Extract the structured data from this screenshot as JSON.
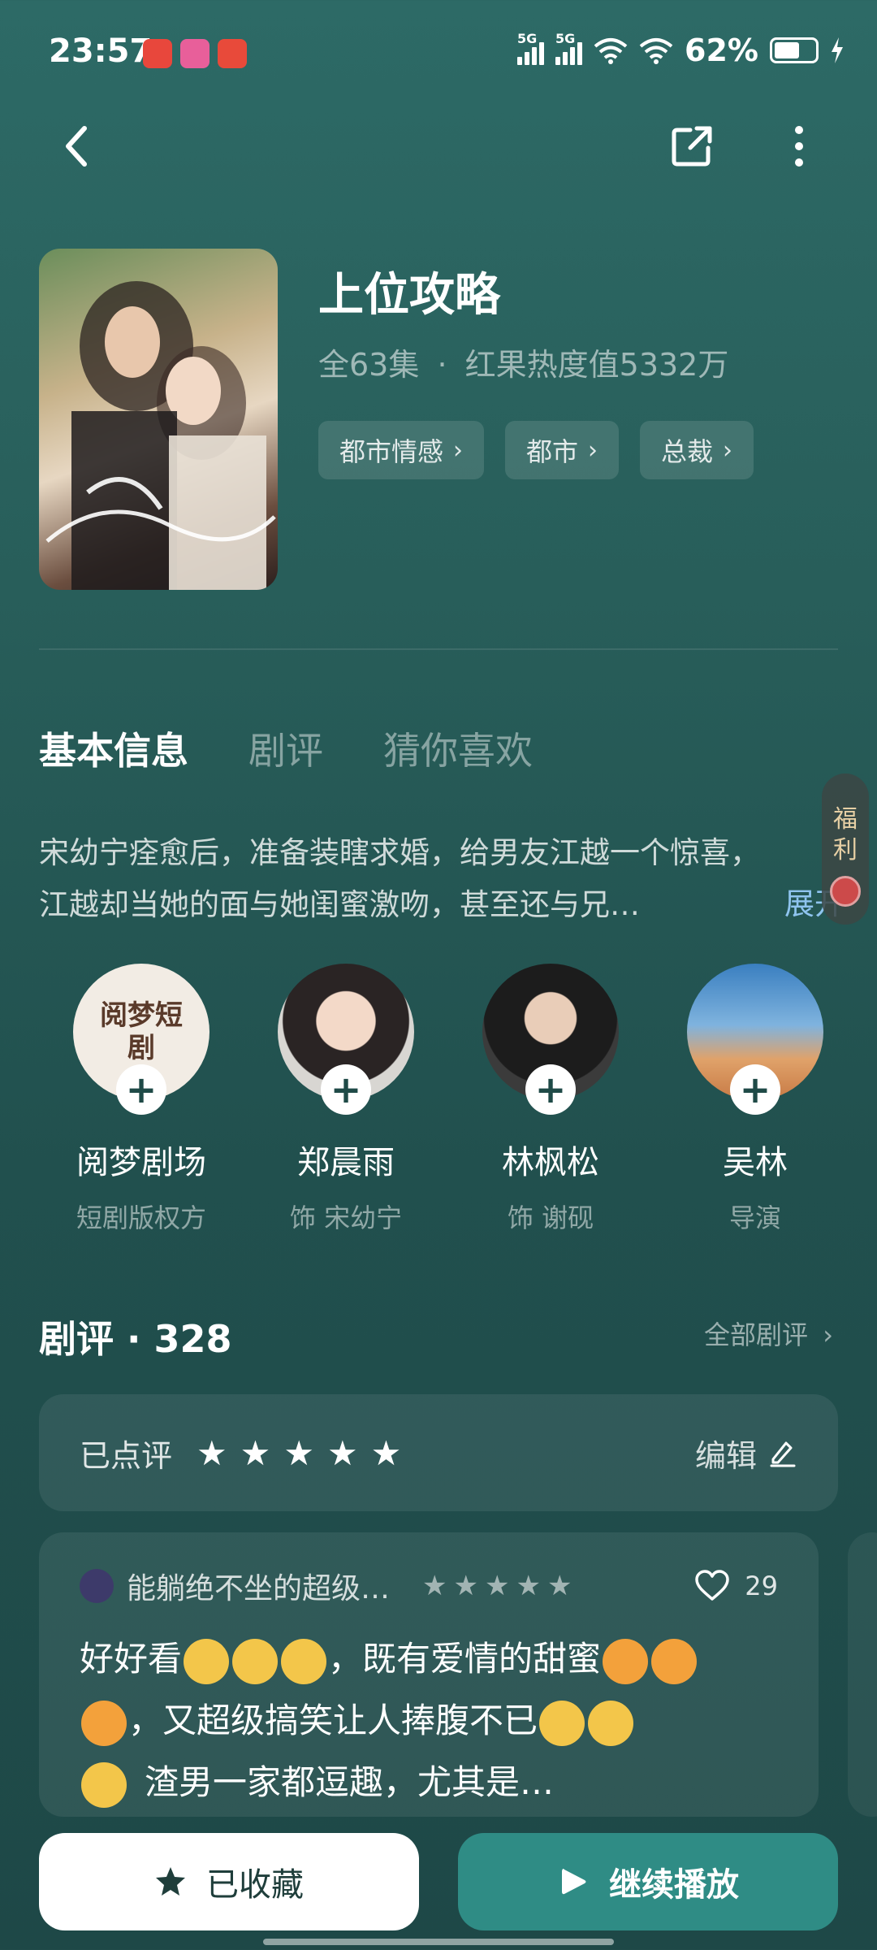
{
  "status_bar": {
    "time": "23:57",
    "network1": "5G",
    "network2": "5G",
    "battery": "62%",
    "battery_level": 0.62
  },
  "drama": {
    "title": "上位攻略",
    "episodes": "全63集",
    "separator": "·",
    "heat": "红果热度值5332万",
    "tags": [
      "都市情感",
      "都市",
      "总裁"
    ]
  },
  "tabs": [
    "基本信息",
    "剧评",
    "猜你喜欢"
  ],
  "synopsis": {
    "line1": "宋幼宁痊愈后，准备装瞎求婚，给男友江越一个惊喜，",
    "line2": "江越却当她的面与她闺蜜激吻，甚至还与兄…",
    "expand_label": "展开"
  },
  "float_badge": {
    "char1": "福",
    "char2": "利"
  },
  "cast": [
    {
      "name": "阅梦剧场",
      "role": "短剧版权方",
      "avatar_text": "阅梦短剧"
    },
    {
      "name": "郑晨雨",
      "role": "饰 宋幼宁"
    },
    {
      "name": "林枫松",
      "role": "饰 谢砚"
    },
    {
      "name": "吴林",
      "role": "导演"
    }
  ],
  "reviews": {
    "title": "剧评 · 328",
    "see_all": "全部剧评",
    "rated_label": "已点评",
    "user_rating": 5,
    "edit_label": "编辑",
    "first": {
      "user": "能躺绝不坐的超级…",
      "stars": 5,
      "likes": "29",
      "text_a": "好好看",
      "text_b": "，既有爱情的甜蜜",
      "text_c": "，又超级搞笑让人捧腹不已",
      "text_d": "渣男一家都逗趣，尤其是…"
    }
  },
  "buttons": {
    "favorite": "已收藏",
    "play": "继续播放"
  },
  "colors": {
    "accent": "#2f8c85",
    "background": "#285e5a",
    "link": "#8fc4ef"
  }
}
